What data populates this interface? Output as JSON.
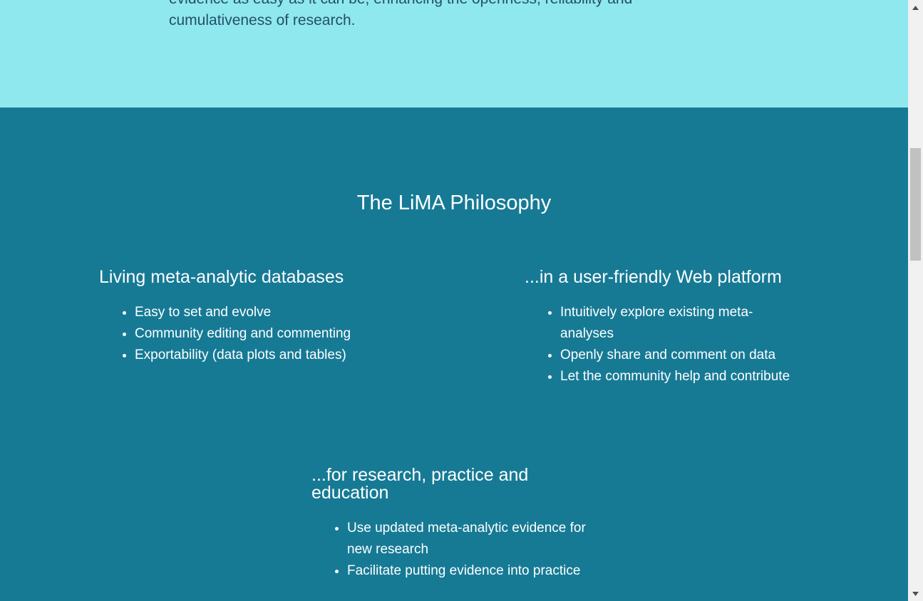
{
  "intro": {
    "line1": "evidence as easy as it can be, enhancing the openness, reliability and",
    "line2": "cumulativeness of research."
  },
  "philosophy": {
    "title": "The LiMA Philosophy",
    "columns": [
      {
        "heading": "Living meta-analytic databases",
        "items": [
          "Easy to set and evolve",
          "Community editing and commenting",
          "Exportability (data plots and tables)"
        ]
      },
      {
        "heading": "...in a user-friendly Web platform",
        "items": [
          "Intuitively explore existing meta-analyses",
          "Openly share and comment on data",
          "Let the community help and contribute"
        ]
      },
      {
        "heading": "...for research, practice and education",
        "items": [
          "Use updated meta-analytic evidence for new research",
          "Facilitate putting evidence into practice"
        ]
      }
    ]
  },
  "colors": {
    "intro_bg": "#8ee8ed",
    "philosophy_bg": "#167a95"
  },
  "scrollbar": {
    "up_icon": "triangle-up",
    "down_icon": "triangle-down"
  }
}
